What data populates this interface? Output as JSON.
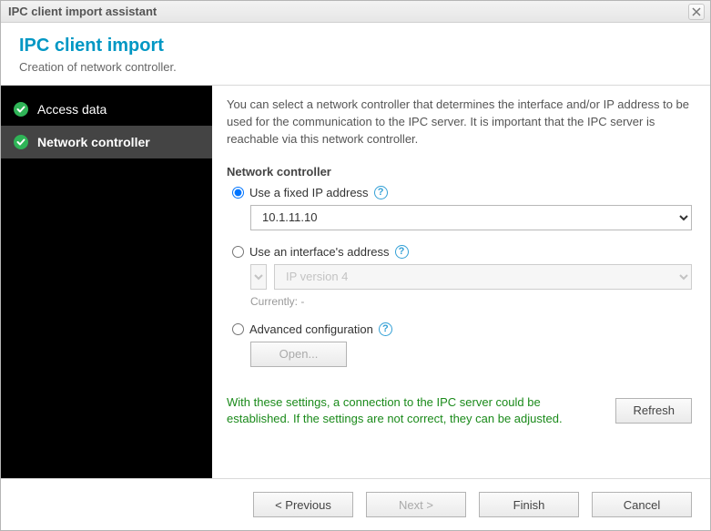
{
  "window": {
    "title": "IPC client import assistant"
  },
  "header": {
    "title": "IPC client import",
    "subtitle": "Creation of network controller."
  },
  "sidebar": {
    "items": [
      {
        "label": "Access data",
        "done": true,
        "active": false
      },
      {
        "label": "Network controller",
        "done": true,
        "active": true
      }
    ]
  },
  "content": {
    "intro": "You can select a network controller that determines the interface and/or IP address to be used for the communication to the IPC server. It is important that the IPC server is reachable via this network controller.",
    "section_title": "Network controller",
    "option_fixed": {
      "label": "Use a fixed IP address",
      "value": "10.1.11.10"
    },
    "option_interface": {
      "label": "Use an interface's address",
      "interface_value": "",
      "ipver_value": "IP version 4",
      "currently_label": "Currently: -"
    },
    "option_advanced": {
      "label": "Advanced configuration",
      "open_label": "Open..."
    },
    "status_msg": "With these settings, a connection to the IPC server could be established. If the settings are not correct, they can be adjusted.",
    "refresh_label": "Refresh"
  },
  "footer": {
    "prev": "< Previous",
    "next": "Next >",
    "finish": "Finish",
    "cancel": "Cancel"
  }
}
